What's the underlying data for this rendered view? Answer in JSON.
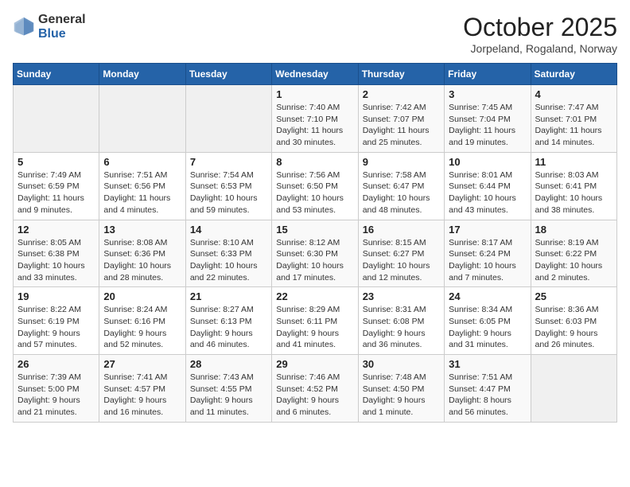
{
  "header": {
    "logo_general": "General",
    "logo_blue": "Blue",
    "month_title": "October 2025",
    "location": "Jorpeland, Rogaland, Norway"
  },
  "weekdays": [
    "Sunday",
    "Monday",
    "Tuesday",
    "Wednesday",
    "Thursday",
    "Friday",
    "Saturday"
  ],
  "weeks": [
    [
      {
        "day": "",
        "info": ""
      },
      {
        "day": "",
        "info": ""
      },
      {
        "day": "",
        "info": ""
      },
      {
        "day": "1",
        "info": "Sunrise: 7:40 AM\nSunset: 7:10 PM\nDaylight: 11 hours\nand 30 minutes."
      },
      {
        "day": "2",
        "info": "Sunrise: 7:42 AM\nSunset: 7:07 PM\nDaylight: 11 hours\nand 25 minutes."
      },
      {
        "day": "3",
        "info": "Sunrise: 7:45 AM\nSunset: 7:04 PM\nDaylight: 11 hours\nand 19 minutes."
      },
      {
        "day": "4",
        "info": "Sunrise: 7:47 AM\nSunset: 7:01 PM\nDaylight: 11 hours\nand 14 minutes."
      }
    ],
    [
      {
        "day": "5",
        "info": "Sunrise: 7:49 AM\nSunset: 6:59 PM\nDaylight: 11 hours\nand 9 minutes."
      },
      {
        "day": "6",
        "info": "Sunrise: 7:51 AM\nSunset: 6:56 PM\nDaylight: 11 hours\nand 4 minutes."
      },
      {
        "day": "7",
        "info": "Sunrise: 7:54 AM\nSunset: 6:53 PM\nDaylight: 10 hours\nand 59 minutes."
      },
      {
        "day": "8",
        "info": "Sunrise: 7:56 AM\nSunset: 6:50 PM\nDaylight: 10 hours\nand 53 minutes."
      },
      {
        "day": "9",
        "info": "Sunrise: 7:58 AM\nSunset: 6:47 PM\nDaylight: 10 hours\nand 48 minutes."
      },
      {
        "day": "10",
        "info": "Sunrise: 8:01 AM\nSunset: 6:44 PM\nDaylight: 10 hours\nand 43 minutes."
      },
      {
        "day": "11",
        "info": "Sunrise: 8:03 AM\nSunset: 6:41 PM\nDaylight: 10 hours\nand 38 minutes."
      }
    ],
    [
      {
        "day": "12",
        "info": "Sunrise: 8:05 AM\nSunset: 6:38 PM\nDaylight: 10 hours\nand 33 minutes."
      },
      {
        "day": "13",
        "info": "Sunrise: 8:08 AM\nSunset: 6:36 PM\nDaylight: 10 hours\nand 28 minutes."
      },
      {
        "day": "14",
        "info": "Sunrise: 8:10 AM\nSunset: 6:33 PM\nDaylight: 10 hours\nand 22 minutes."
      },
      {
        "day": "15",
        "info": "Sunrise: 8:12 AM\nSunset: 6:30 PM\nDaylight: 10 hours\nand 17 minutes."
      },
      {
        "day": "16",
        "info": "Sunrise: 8:15 AM\nSunset: 6:27 PM\nDaylight: 10 hours\nand 12 minutes."
      },
      {
        "day": "17",
        "info": "Sunrise: 8:17 AM\nSunset: 6:24 PM\nDaylight: 10 hours\nand 7 minutes."
      },
      {
        "day": "18",
        "info": "Sunrise: 8:19 AM\nSunset: 6:22 PM\nDaylight: 10 hours\nand 2 minutes."
      }
    ],
    [
      {
        "day": "19",
        "info": "Sunrise: 8:22 AM\nSunset: 6:19 PM\nDaylight: 9 hours\nand 57 minutes."
      },
      {
        "day": "20",
        "info": "Sunrise: 8:24 AM\nSunset: 6:16 PM\nDaylight: 9 hours\nand 52 minutes."
      },
      {
        "day": "21",
        "info": "Sunrise: 8:27 AM\nSunset: 6:13 PM\nDaylight: 9 hours\nand 46 minutes."
      },
      {
        "day": "22",
        "info": "Sunrise: 8:29 AM\nSunset: 6:11 PM\nDaylight: 9 hours\nand 41 minutes."
      },
      {
        "day": "23",
        "info": "Sunrise: 8:31 AM\nSunset: 6:08 PM\nDaylight: 9 hours\nand 36 minutes."
      },
      {
        "day": "24",
        "info": "Sunrise: 8:34 AM\nSunset: 6:05 PM\nDaylight: 9 hours\nand 31 minutes."
      },
      {
        "day": "25",
        "info": "Sunrise: 8:36 AM\nSunset: 6:03 PM\nDaylight: 9 hours\nand 26 minutes."
      }
    ],
    [
      {
        "day": "26",
        "info": "Sunrise: 7:39 AM\nSunset: 5:00 PM\nDaylight: 9 hours\nand 21 minutes."
      },
      {
        "day": "27",
        "info": "Sunrise: 7:41 AM\nSunset: 4:57 PM\nDaylight: 9 hours\nand 16 minutes."
      },
      {
        "day": "28",
        "info": "Sunrise: 7:43 AM\nSunset: 4:55 PM\nDaylight: 9 hours\nand 11 minutes."
      },
      {
        "day": "29",
        "info": "Sunrise: 7:46 AM\nSunset: 4:52 PM\nDaylight: 9 hours\nand 6 minutes."
      },
      {
        "day": "30",
        "info": "Sunrise: 7:48 AM\nSunset: 4:50 PM\nDaylight: 9 hours\nand 1 minute."
      },
      {
        "day": "31",
        "info": "Sunrise: 7:51 AM\nSunset: 4:47 PM\nDaylight: 8 hours\nand 56 minutes."
      },
      {
        "day": "",
        "info": ""
      }
    ]
  ]
}
